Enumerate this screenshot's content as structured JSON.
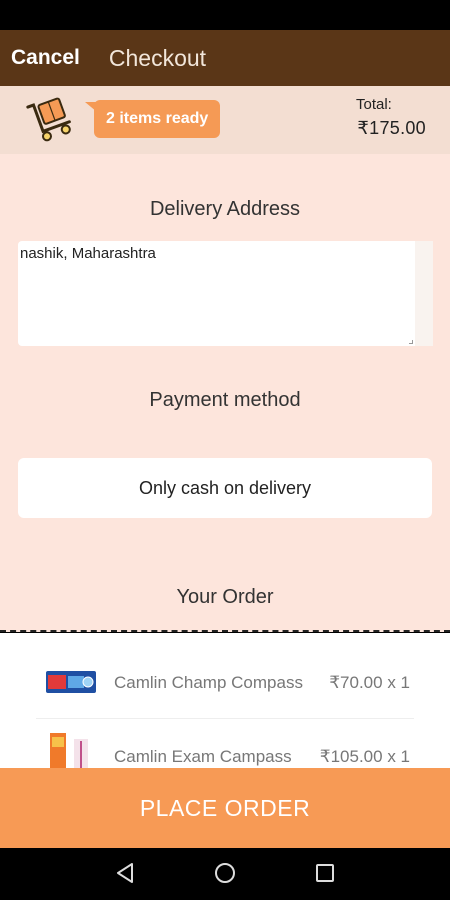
{
  "app_bar": {
    "cancel_label": "Cancel",
    "title": "Checkout"
  },
  "summary": {
    "cart_icon": "hand-truck-icon",
    "items_ready": "2 items ready",
    "total_label": "Total:",
    "total_amount": "₹175.00"
  },
  "delivery": {
    "title": "Delivery Address",
    "address": "nashik, Maharashtra"
  },
  "payment": {
    "title": "Payment method",
    "method": "Only cash on delivery"
  },
  "order": {
    "title": "Your Order",
    "items": [
      {
        "name": "Camlin Champ Compass",
        "price": "₹70.00 x 1",
        "thumb": "compass-box-thumbnail"
      },
      {
        "name": "Camlin Exam Campass",
        "price": "₹105.00 x 1",
        "thumb": "compass-box-thumbnail"
      }
    ]
  },
  "place_order_label": "PLACE ORDER",
  "nav": {
    "back_icon": "back-triangle-icon",
    "home_icon": "home-circle-icon",
    "recent_icon": "recents-square-icon"
  },
  "colors": {
    "app_bar": "#5a3617",
    "accent": "#f59a55",
    "background": "#fde5dc"
  }
}
